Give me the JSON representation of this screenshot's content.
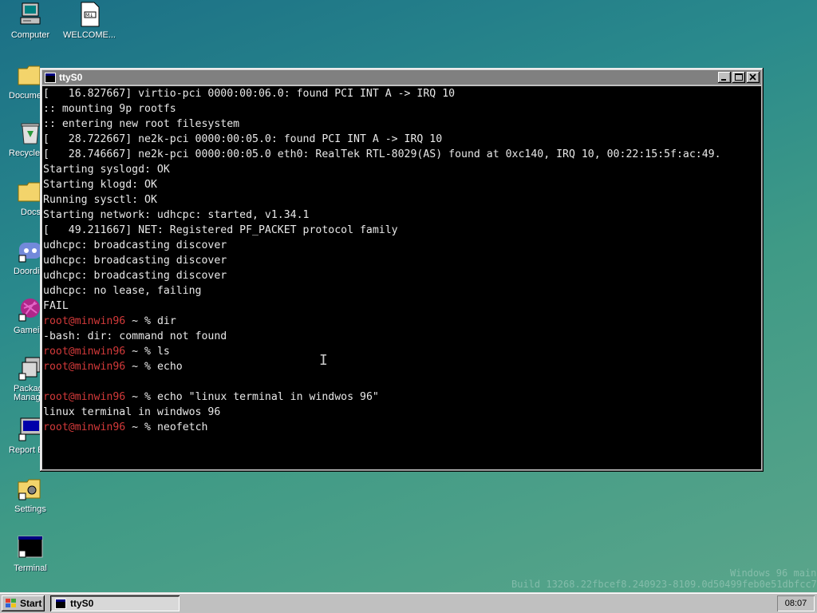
{
  "desktop": {
    "icons": [
      {
        "label": "Computer",
        "icon": "computer-icon"
      },
      {
        "label": "WELCOME...",
        "icon": "markdown-file-icon"
      },
      {
        "label": "Docume",
        "icon": "folder-icon"
      },
      {
        "label": "Recycle",
        "icon": "recycle-bin-icon"
      },
      {
        "label": "Docs",
        "icon": "folder-icon"
      },
      {
        "label": "Doordi",
        "icon": "discord-icon"
      },
      {
        "label": "Gamein",
        "icon": "game-icon"
      },
      {
        "label": "Packag\nManag",
        "icon": "package-manager-icon"
      },
      {
        "label": "Report B",
        "icon": "report-bug-icon"
      },
      {
        "label": "Settings",
        "icon": "settings-icon"
      },
      {
        "label": "Terminal",
        "icon": "terminal-icon"
      }
    ],
    "watermark": {
      "line1": "Windows 96 main",
      "line2": "Build 13268.22fbcef8.240923-8109.0d50499feb0e51dbfcc7"
    }
  },
  "window": {
    "title": "ttyS0",
    "controls": {
      "minimize": "_",
      "maximize": "□",
      "close": "×"
    }
  },
  "terminal": {
    "lines": [
      {
        "text": "[   16.827667] virtio-pci 0000:00:06.0: found PCI INT A -> IRQ 10"
      },
      {
        "text": ":: mounting 9p rootfs"
      },
      {
        "text": ":: entering new root filesystem"
      },
      {
        "text": "[   28.722667] ne2k-pci 0000:00:05.0: found PCI INT A -> IRQ 10"
      },
      {
        "text": "[   28.746667] ne2k-pci 0000:00:05.0 eth0: RealTek RTL-8029(AS) found at 0xc140, IRQ 10, 00:22:15:5f:ac:49."
      },
      {
        "text": "Starting syslogd: OK"
      },
      {
        "text": "Starting klogd: OK"
      },
      {
        "text": "Running sysctl: OK"
      },
      {
        "text": "Starting network: udhcpc: started, v1.34.1"
      },
      {
        "text": "[   49.211667] NET: Registered PF_PACKET protocol family"
      },
      {
        "text": "udhcpc: broadcasting discover"
      },
      {
        "text": "udhcpc: broadcasting discover"
      },
      {
        "text": "udhcpc: broadcasting discover"
      },
      {
        "text": "udhcpc: no lease, failing"
      },
      {
        "text": "FAIL"
      },
      {
        "user": "root",
        "host": "@minwin96",
        "prompt": " ~ % ",
        "cmd": "dir"
      },
      {
        "text": "-bash: dir: command not found"
      },
      {
        "user": "root",
        "host": "@minwin96",
        "prompt": " ~ % ",
        "cmd": "ls"
      },
      {
        "user": "root",
        "host": "@minwin96",
        "prompt": " ~ % ",
        "cmd": "echo"
      },
      {
        "text": ""
      },
      {
        "user": "root",
        "host": "@minwin96",
        "prompt": " ~ % ",
        "cmd": "echo \"linux terminal in windwos 96\""
      },
      {
        "text": "linux terminal in windwos 96"
      },
      {
        "user": "root",
        "host": "@minwin96",
        "prompt": " ~ % ",
        "cmd": "neofetch"
      }
    ],
    "colors": {
      "user": "#d43a3a",
      "text": "#e8e8e8",
      "background": "#000000"
    }
  },
  "taskbar": {
    "start_label": "Start",
    "task_label": "ttyS0",
    "clock": "08:07"
  }
}
